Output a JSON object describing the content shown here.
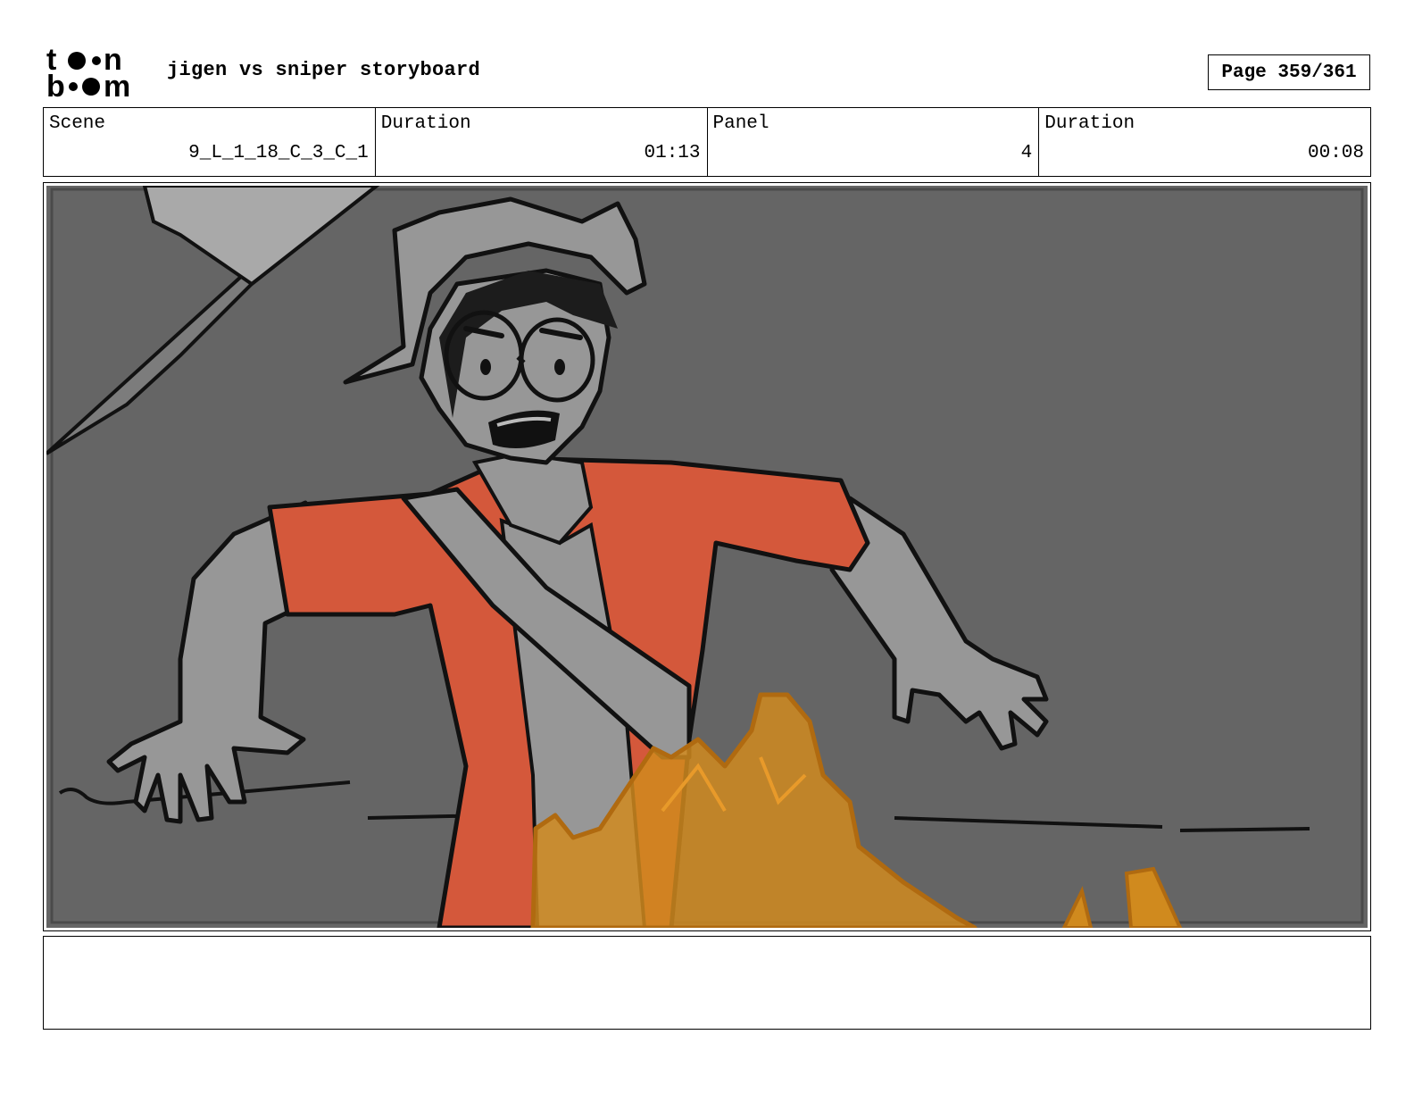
{
  "header": {
    "logo": {
      "text_top": "toon",
      "text_bottom": "boom"
    },
    "title": "jigen vs sniper storyboard",
    "page_label": "Page 359/361"
  },
  "info": {
    "scene_label": "Scene",
    "scene_value": "9_L_1_18_C_3_C_1",
    "scene_duration_label": "Duration",
    "scene_duration_value": "01:13",
    "panel_label": "Panel",
    "panel_value": "4",
    "panel_duration_label": "Duration",
    "panel_duration_value": "00:08"
  },
  "panel": {
    "background_color": "#656565",
    "shirt_color": "#d4583b",
    "effect_color": "#d08a1e"
  },
  "notes": {
    "text": ""
  }
}
